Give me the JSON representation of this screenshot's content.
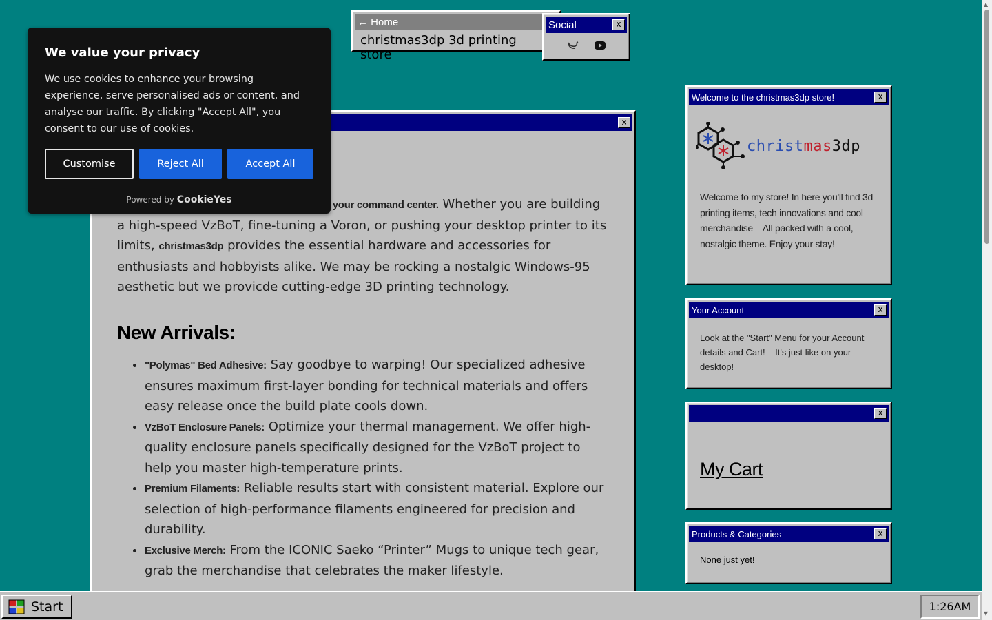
{
  "home_window": {
    "title": "← Home",
    "store_name": "christmas3dp 3d printing store"
  },
  "social_window": {
    "title": "Social",
    "close": "x",
    "icons": [
      "twitter-icon",
      "youtube-icon"
    ]
  },
  "main_window": {
    "close": "x",
    "intro_bold": "o your command center.",
    "intro_text_1": " Whether you are building a high-speed VzBoT, fine-tuning a Voron, or pushing your desktop printer to its limits, ",
    "intro_brand": "christmas3dp",
    "intro_text_2": " provides the essential hardware and accessories for enthusiasts and hobbyists alike. We may be rocking a nostalgic Windows-95 aesthetic but we provicde cutting-edge 3D printing technology.",
    "heading": "New Arrivals:",
    "items": [
      {
        "bold": "\"Polymas\" Bed Adhesive:",
        "text": " Say goodbye to warping! Our specialized adhesive ensures maximum first-layer bonding for technical materials and offers easy release once the build plate cools down."
      },
      {
        "bold": "VzBoT Enclosure Panels:",
        "text": " Optimize your thermal management. We offer high-quality enclosure panels specifically designed for the VzBoT project to help you master high-temperature prints."
      },
      {
        "bold": "Premium Filaments:",
        "text": " Reliable results start with consistent material. Explore our selection of high-performance filaments engineered for precision and durability."
      },
      {
        "bold": "Exclusive Merch:",
        "text": " From the ICONIC Saeko “Printer” Mugs to unique tech gear, grab the merchandise that celebrates the maker lifestyle."
      }
    ]
  },
  "cookie_banner": {
    "title": "We value your privacy",
    "text": "We use cookies to enhance your browsing experience, serve personalised ads or content, and analyse our traffic. By clicking \"Accept All\", you consent to our use of cookies.",
    "customise": "Customise",
    "reject": "Reject All",
    "accept": "Accept All",
    "powered_by": "Powered by",
    "brand": "CookieYes"
  },
  "welcome_window": {
    "title": "Welcome to the christmas3dp store!",
    "close": "x",
    "logo_parts": {
      "a": "christ",
      "b": "mas",
      "c": "3dp"
    },
    "text": "Welcome to my store! In here you'll find 3d printing items, tech innovations and cool merchandise – All packed with a cool, nostalgic theme. Enjoy your stay!"
  },
  "account_window": {
    "title": "Your Account",
    "close": "x",
    "text": "Look at the \"Start\" Menu for your Account details and Cart! – It's just like on your desktop!"
  },
  "cart_window": {
    "title": "",
    "close": "x",
    "link": "My Cart"
  },
  "products_window": {
    "title": "Products & Categories",
    "close": "x",
    "link": "None just yet!"
  },
  "taskbar": {
    "start": "Start",
    "clock": "1:26AM"
  },
  "colors": {
    "desktop": "#008080",
    "titlebar": "#000080",
    "window": "#c0c0c0",
    "cookie_bg": "#121212",
    "cookie_button": "#1863dc"
  }
}
